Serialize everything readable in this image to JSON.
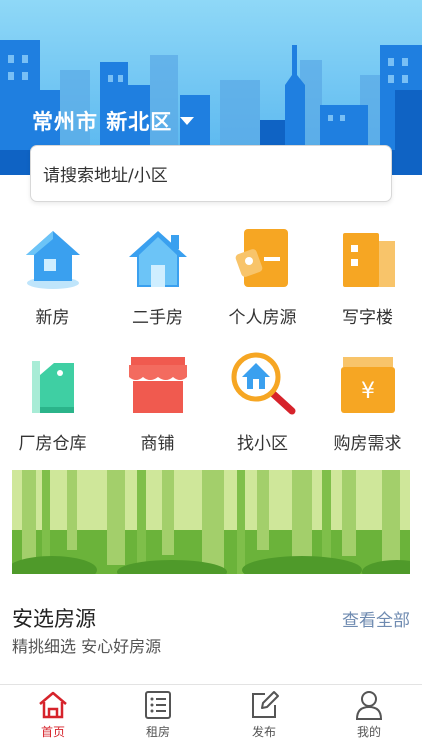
{
  "location": {
    "city": "常州市 新北区"
  },
  "search": {
    "placeholder": "请搜索地址/小区"
  },
  "categories": [
    {
      "label": "新房",
      "icon": "new-house-icon"
    },
    {
      "label": "二手房",
      "icon": "second-hand-house-icon"
    },
    {
      "label": "个人房源",
      "icon": "personal-listing-icon"
    },
    {
      "label": "写字楼",
      "icon": "office-building-icon"
    },
    {
      "label": "厂房仓库",
      "icon": "factory-warehouse-icon"
    },
    {
      "label": "商铺",
      "icon": "shop-icon"
    },
    {
      "label": "找小区",
      "icon": "find-community-icon"
    },
    {
      "label": "购房需求",
      "icon": "purchase-demand-icon"
    }
  ],
  "section": {
    "title": "安选房源",
    "subtitle": "精挑细选 安心好房源",
    "more": "查看全部"
  },
  "tabs": [
    {
      "label": "首页",
      "icon": "home-icon",
      "active": true
    },
    {
      "label": "租房",
      "icon": "list-icon",
      "active": false
    },
    {
      "label": "发布",
      "icon": "edit-icon",
      "active": false
    },
    {
      "label": "我的",
      "icon": "user-icon",
      "active": false
    }
  ],
  "colors": {
    "accent": "#d6232b",
    "sky": "#6cc6f2",
    "link": "#6f8bb1"
  }
}
